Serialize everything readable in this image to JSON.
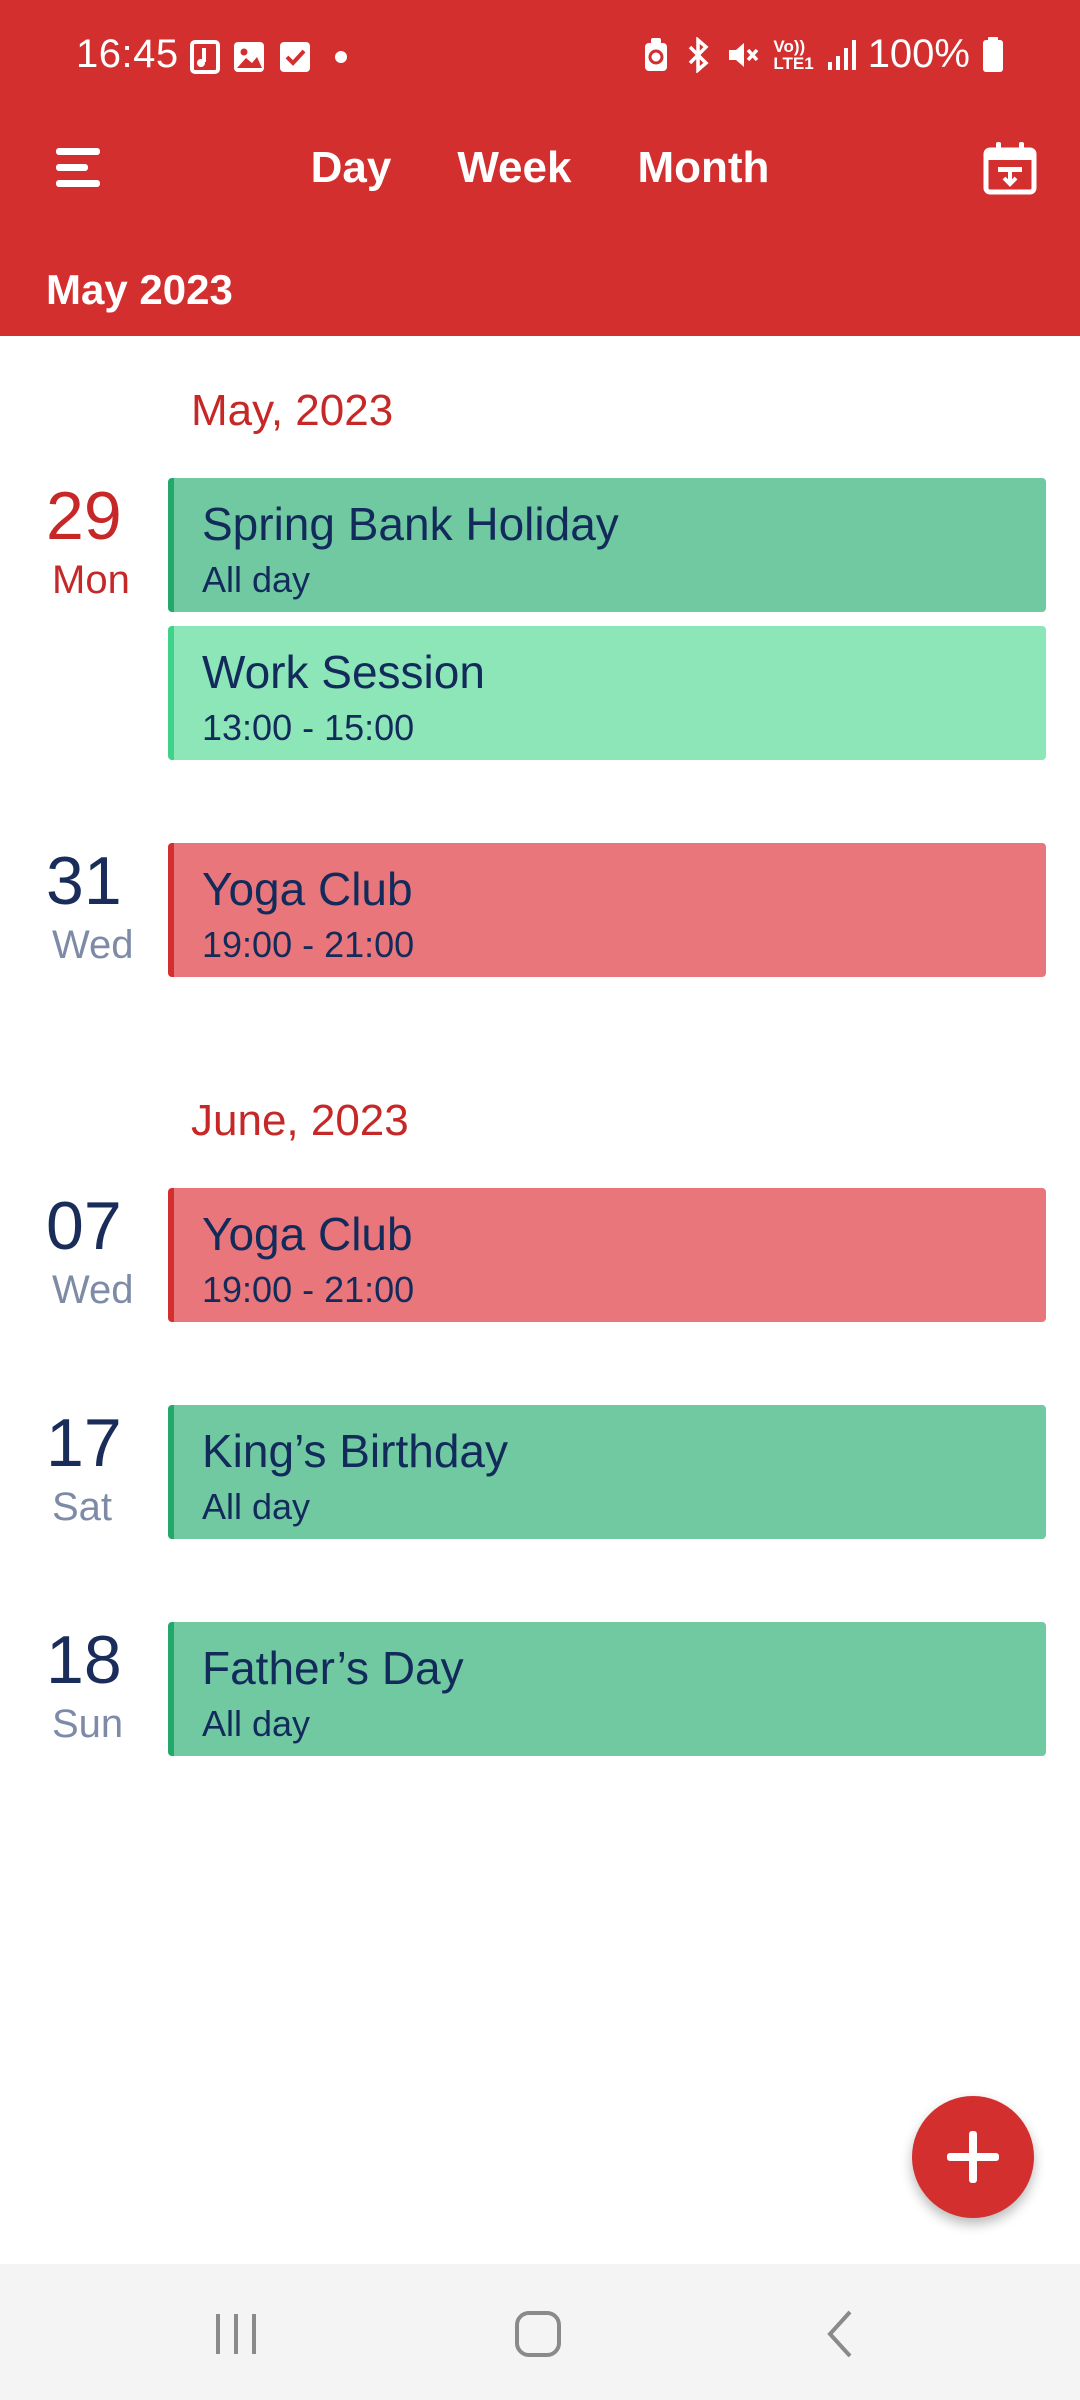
{
  "status_bar": {
    "time": "16:45",
    "left_icons": [
      "music-file-icon",
      "image-icon",
      "checkbox-icon",
      "dot-icon"
    ],
    "right_icons": [
      "battery-saver-icon",
      "bluetooth-icon",
      "mute-icon",
      "volte-icon",
      "signal-icon",
      "battery-icon"
    ],
    "volte_line1": "Vo))",
    "volte_line2": "LTE1",
    "battery": "100%"
  },
  "toolbar": {
    "menu_icon": "hamburger-menu-icon",
    "tabs": [
      "Day",
      "Week",
      "Month"
    ],
    "calendar_icon": "calendar-today-icon",
    "current_period": "May 2023"
  },
  "agenda": {
    "sections": [
      {
        "title": "May, 2023",
        "days": [
          {
            "number": "29",
            "weekday": "Mon",
            "today": true,
            "events": [
              {
                "title": "Spring Bank Holiday",
                "sub": "All day",
                "color": "#71C9A1"
              },
              {
                "title": "Work Session",
                "sub": "13:00 - 15:00",
                "color": "#8DE6B8"
              }
            ]
          },
          {
            "number": "31",
            "weekday": "Wed",
            "today": false,
            "events": [
              {
                "title": "Yoga Club",
                "sub": "19:00 - 21:00",
                "color": "#E8767A"
              }
            ]
          }
        ]
      },
      {
        "title": "June, 2023",
        "days": [
          {
            "number": "07",
            "weekday": "Wed",
            "today": false,
            "events": [
              {
                "title": "Yoga Club",
                "sub": "19:00 - 21:00",
                "color": "#E8767A"
              }
            ]
          },
          {
            "number": "17",
            "weekday": "Sat",
            "today": false,
            "events": [
              {
                "title": "King’s Birthday",
                "sub": "All day",
                "color": "#71C9A1"
              }
            ]
          },
          {
            "number": "18",
            "weekday": "Sun",
            "today": false,
            "events": [
              {
                "title": "Father’s Day",
                "sub": "All day",
                "color": "#71C9A1"
              }
            ]
          }
        ]
      }
    ]
  },
  "fab": {
    "icon": "plus-icon"
  },
  "system_nav": {
    "icons": [
      "recent-apps-icon",
      "home-icon",
      "back-icon"
    ]
  },
  "colors": {
    "primary": "#D32F2F",
    "holiday": "#71C9A1",
    "work": "#8DE6B8",
    "yoga": "#E8767A",
    "text_dark": "#132B5B"
  }
}
